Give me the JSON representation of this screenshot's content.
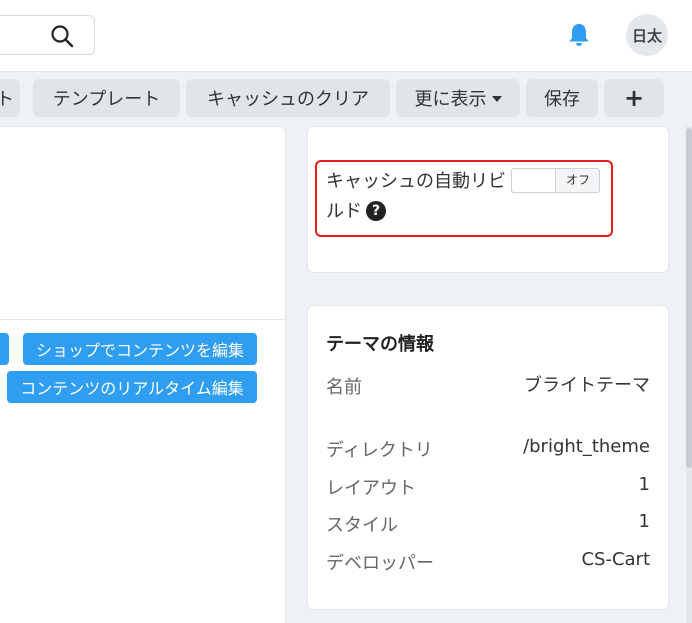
{
  "header": {
    "search_icon": "search-icon",
    "bell_icon": "bell-icon",
    "avatar_initials": "日太",
    "accent_color": "#2f9df0"
  },
  "toolbar": {
    "partial_label": "ト",
    "templates_label": "テンプレート",
    "clear_cache_label": "キャッシュのクリア",
    "more_label": "更に表示",
    "save_label": "保存",
    "add_label": "+"
  },
  "left_panel": {
    "edit_in_shop_label": "ショップでコンテンツを編集",
    "live_edit_label": "コンテンツのリアルタイム編集"
  },
  "cache_setting": {
    "label": "キャッシュの自動リビルド",
    "help_symbol": "?",
    "toggle_state": "オフ"
  },
  "theme_info": {
    "title": "テーマの情報",
    "rows": [
      {
        "label": "名前",
        "value": "ブライトテーマ"
      },
      {
        "label": "ディレクトリ",
        "value": "/bright_theme"
      },
      {
        "label": "レイアウト",
        "value": "1"
      },
      {
        "label": "スタイル",
        "value": "1"
      },
      {
        "label": "デベロッパー",
        "value": "CS-Cart"
      }
    ]
  }
}
